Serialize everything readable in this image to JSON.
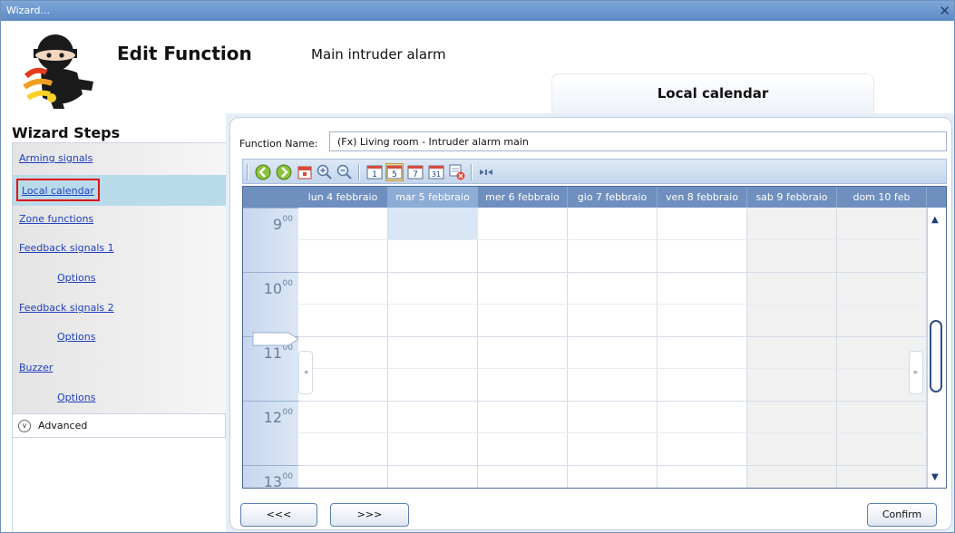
{
  "window": {
    "title": "Wizard...",
    "close_glyph": "✕"
  },
  "header": {
    "title": "Edit Function",
    "subtitle": "Main intruder alarm",
    "active_tab": "Local calendar",
    "logo_icon": "intruder-alarm-logo-icon"
  },
  "sidebar": {
    "title": "Wizard Steps",
    "items": [
      {
        "label": "Arming signals",
        "level": 0
      },
      {
        "label": "Local calendar",
        "level": 0,
        "selected": true
      },
      {
        "label": "Zone functions",
        "level": 0
      },
      {
        "label": "Feedback signals 1",
        "level": 0
      },
      {
        "label": "Options",
        "level": 1
      },
      {
        "label": "Feedback signals 2",
        "level": 0
      },
      {
        "label": "Options",
        "level": 1
      },
      {
        "label": "Buzzer",
        "level": 0
      },
      {
        "label": "Options",
        "level": 1
      }
    ],
    "advanced_label": "Advanced"
  },
  "form": {
    "function_name_label": "Function Name:",
    "function_name_value": "(Fx) Living room - Intruder alarm main"
  },
  "toolbar": {
    "icons": [
      "go-back-icon",
      "go-forward-icon",
      "today-icon",
      "zoom-in-icon",
      "zoom-out-icon",
      "day-view-icon",
      "work-week-view-icon",
      "week-view-icon",
      "month-view-icon",
      "delete-event-icon",
      "compress-icon"
    ]
  },
  "calendar": {
    "days": [
      {
        "label": "lun 4 febbraio",
        "weekend": false
      },
      {
        "label": "mar 5 febbraio",
        "weekend": false,
        "selected": true
      },
      {
        "label": "mer 6 febbraio",
        "weekend": false
      },
      {
        "label": "gio 7 febbraio",
        "weekend": false
      },
      {
        "label": "ven 8 febbraio",
        "weekend": false
      },
      {
        "label": "sab 9 febbraio",
        "weekend": true
      },
      {
        "label": "dom 10 feb",
        "weekend": true
      }
    ],
    "hours": [
      {
        "h": "9",
        "m": "00"
      },
      {
        "h": "10",
        "m": "00"
      },
      {
        "h": "11",
        "m": "00"
      },
      {
        "h": "12",
        "m": "00"
      },
      {
        "h": "13",
        "m": "00"
      }
    ],
    "nav_left_glyph": "◂",
    "nav_right_glyph": "▸",
    "scroll_up_glyph": "▲",
    "scroll_down_glyph": "▼"
  },
  "footer": {
    "back_label": "<<<",
    "next_label": ">>>",
    "confirm_label": "Confirm"
  }
}
